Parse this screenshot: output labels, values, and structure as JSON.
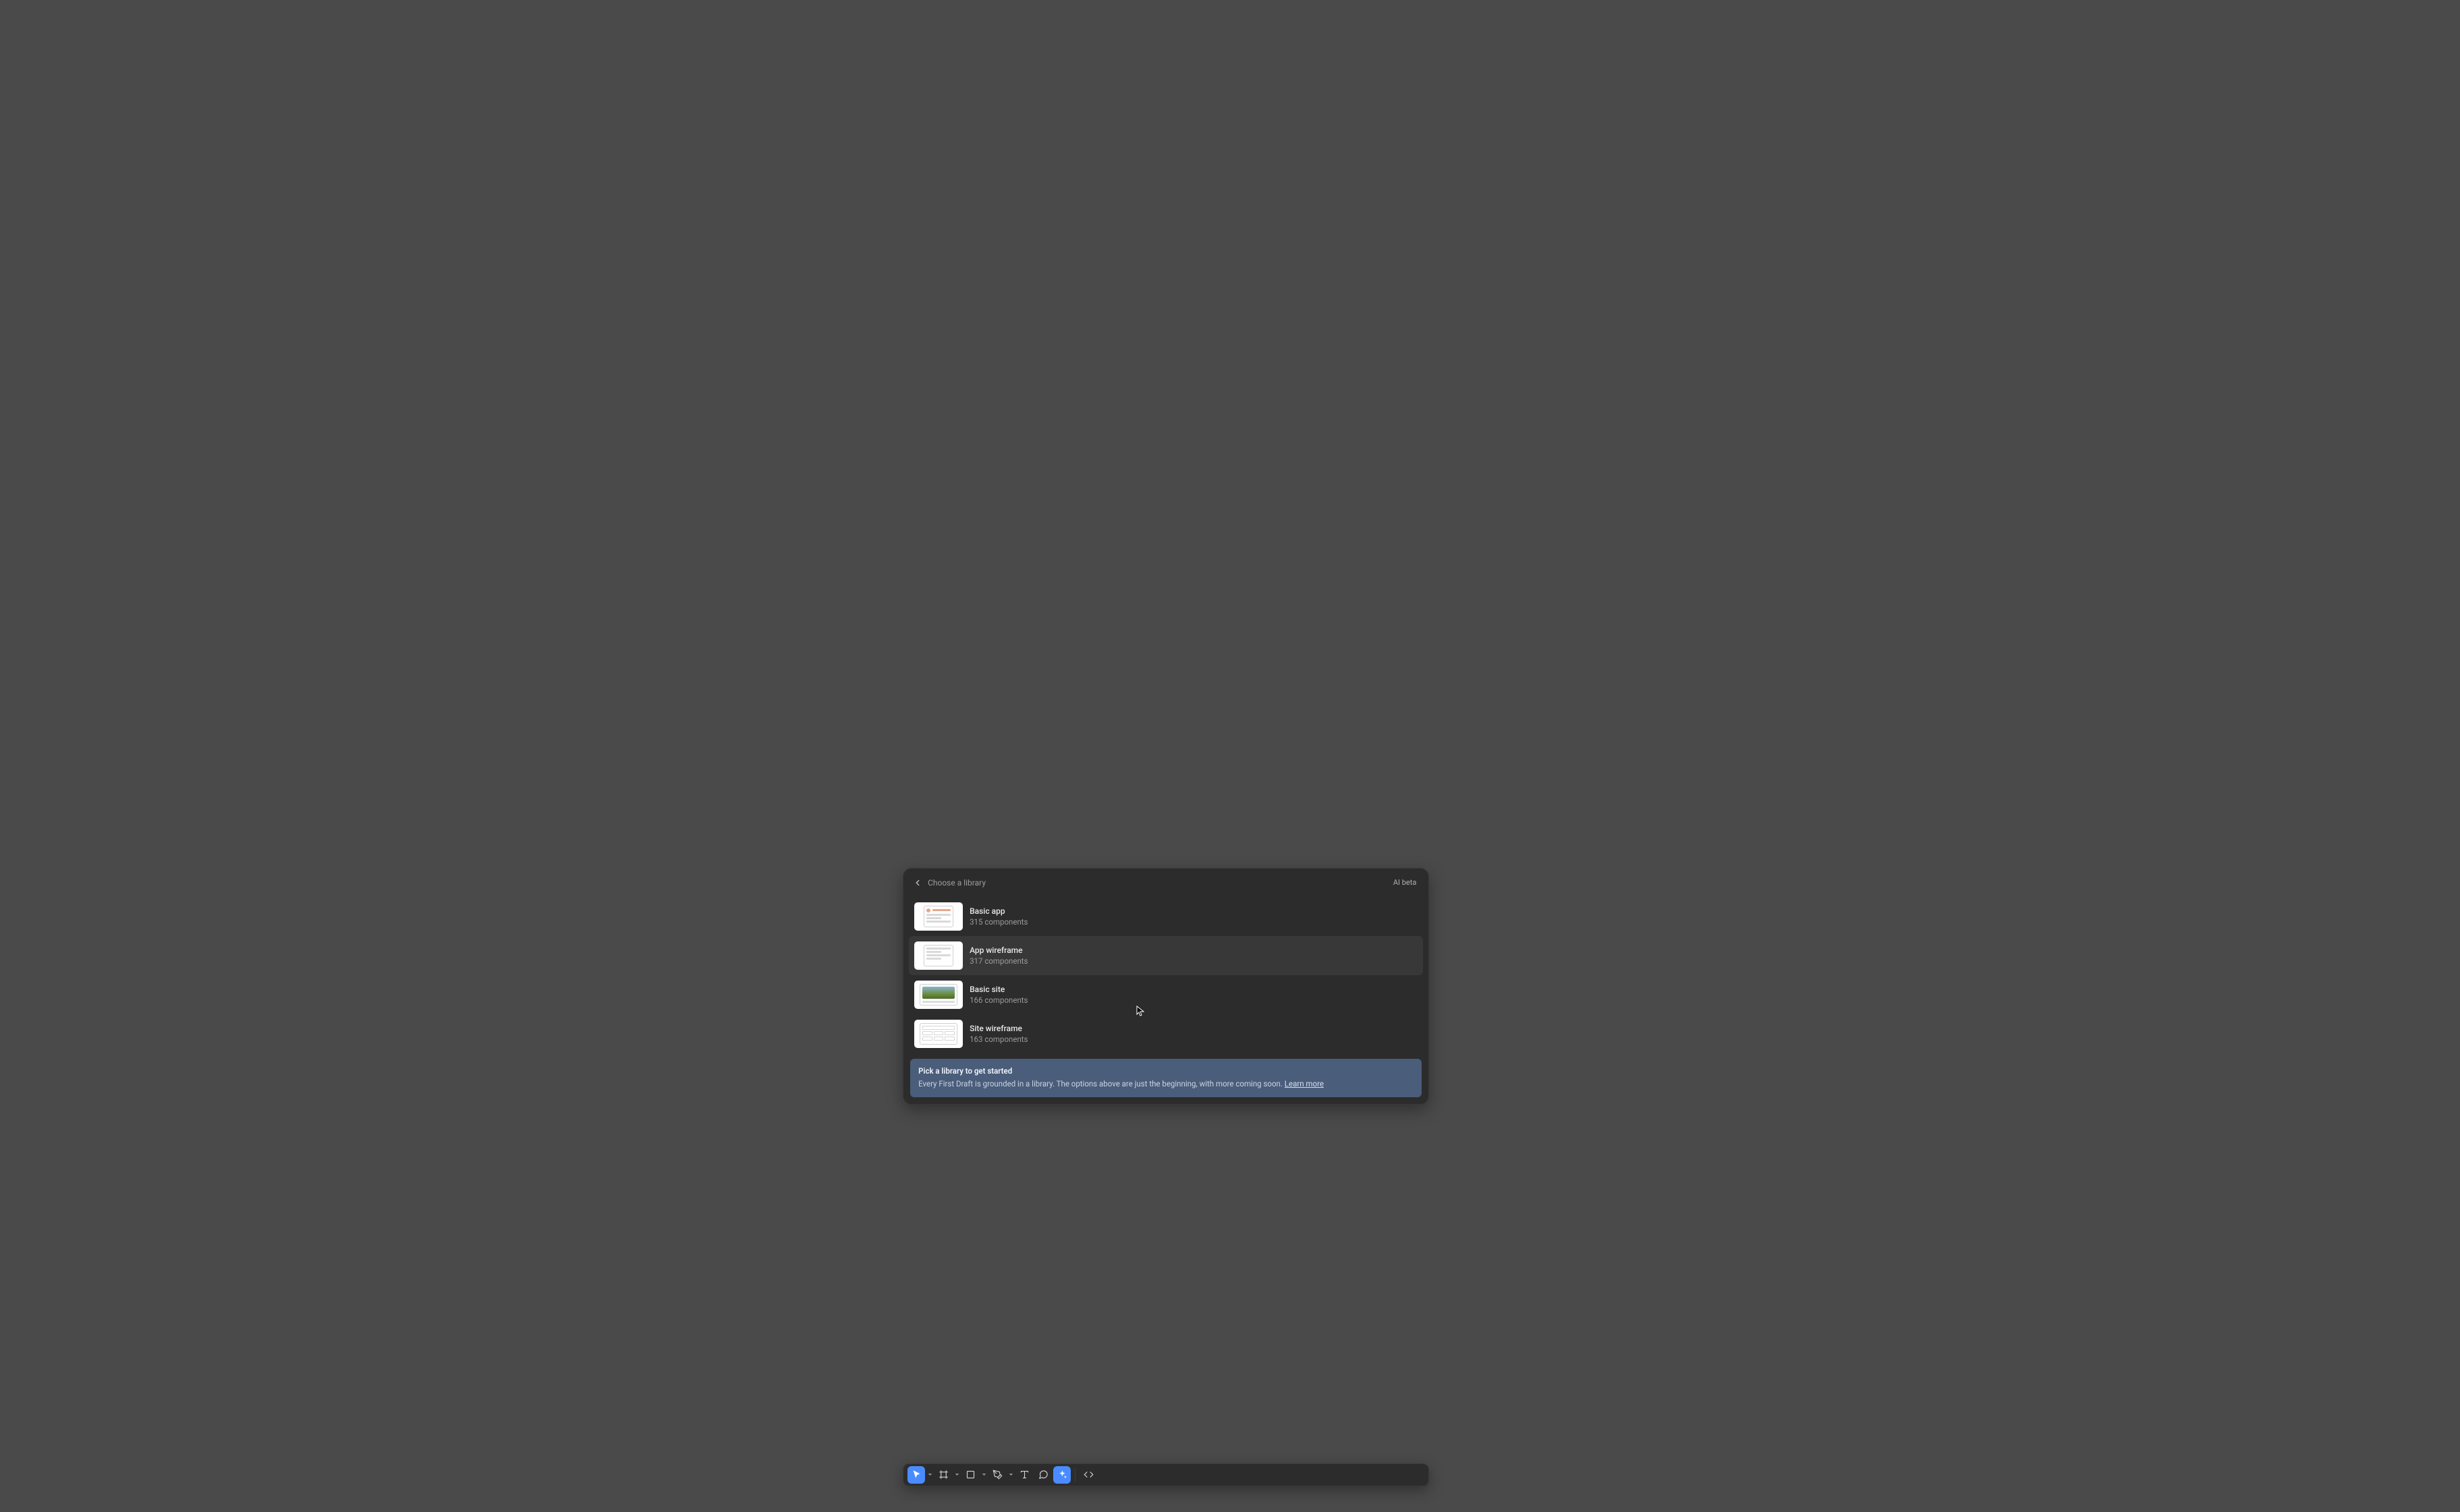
{
  "modal": {
    "title": "Choose a library",
    "badge": "AI beta",
    "libraries": [
      {
        "name": "Basic app",
        "count": "315 components"
      },
      {
        "name": "App wireframe",
        "count": "317 components"
      },
      {
        "name": "Basic site",
        "count": "166 components"
      },
      {
        "name": "Site wireframe",
        "count": "163 components"
      }
    ],
    "callout": {
      "title": "Pick a library to get started",
      "body": "Every First Draft is grounded in a library. The options above are just the beginning, with more coming soon. ",
      "link": "Learn more"
    }
  },
  "toolbar": {
    "tools": {
      "move": "Move",
      "frame": "Frame",
      "rectangle": "Rectangle",
      "pen": "Pen",
      "text": "Text",
      "comment": "Comment",
      "ai": "AI actions",
      "devmode": "Dev mode"
    }
  }
}
